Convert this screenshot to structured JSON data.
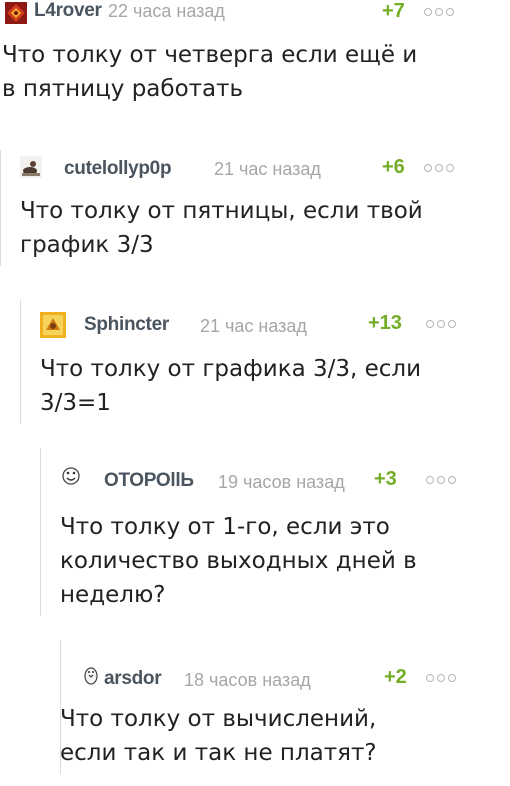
{
  "colors": {
    "username": "#4a5560",
    "timestamp": "#a6a6a6",
    "rating_positive": "#74ad26",
    "body_text": "#222222",
    "thread_line": "#dcdcdc"
  },
  "comments": [
    {
      "username": "L4rover",
      "time": "22 часа назад",
      "rating": "+7",
      "avatar_icon": "red-emblem-avatar-icon",
      "text": "Что толку от четверга если ещё и\nв пятницу работать"
    },
    {
      "username": "cutelollyp0p",
      "time": "21 час назад",
      "rating": "+6",
      "avatar_icon": "photo-avatar-icon",
      "text": "Что толку от пятницы, если твой\nграфик 3/3"
    },
    {
      "username": "Sphincter",
      "time": "21 час назад",
      "rating": "+13",
      "avatar_icon": "gold-frame-avatar-icon",
      "text": "Что толку от графика 3/3, если\n3/3=1"
    },
    {
      "username": "ОТОРОllЬ",
      "time": "19 часов назад",
      "rating": "+3",
      "avatar_icon": "smiley-face-avatar-icon",
      "text": "Что толку от 1-го, если это\nколичество выходных дней в\nнеделю?"
    },
    {
      "username": "arsdor",
      "time": "18 часов назад",
      "rating": "+2",
      "avatar_icon": "penguin-avatar-icon",
      "text": "Что толку от вычислений,\nесли так и так не платят?"
    }
  ]
}
